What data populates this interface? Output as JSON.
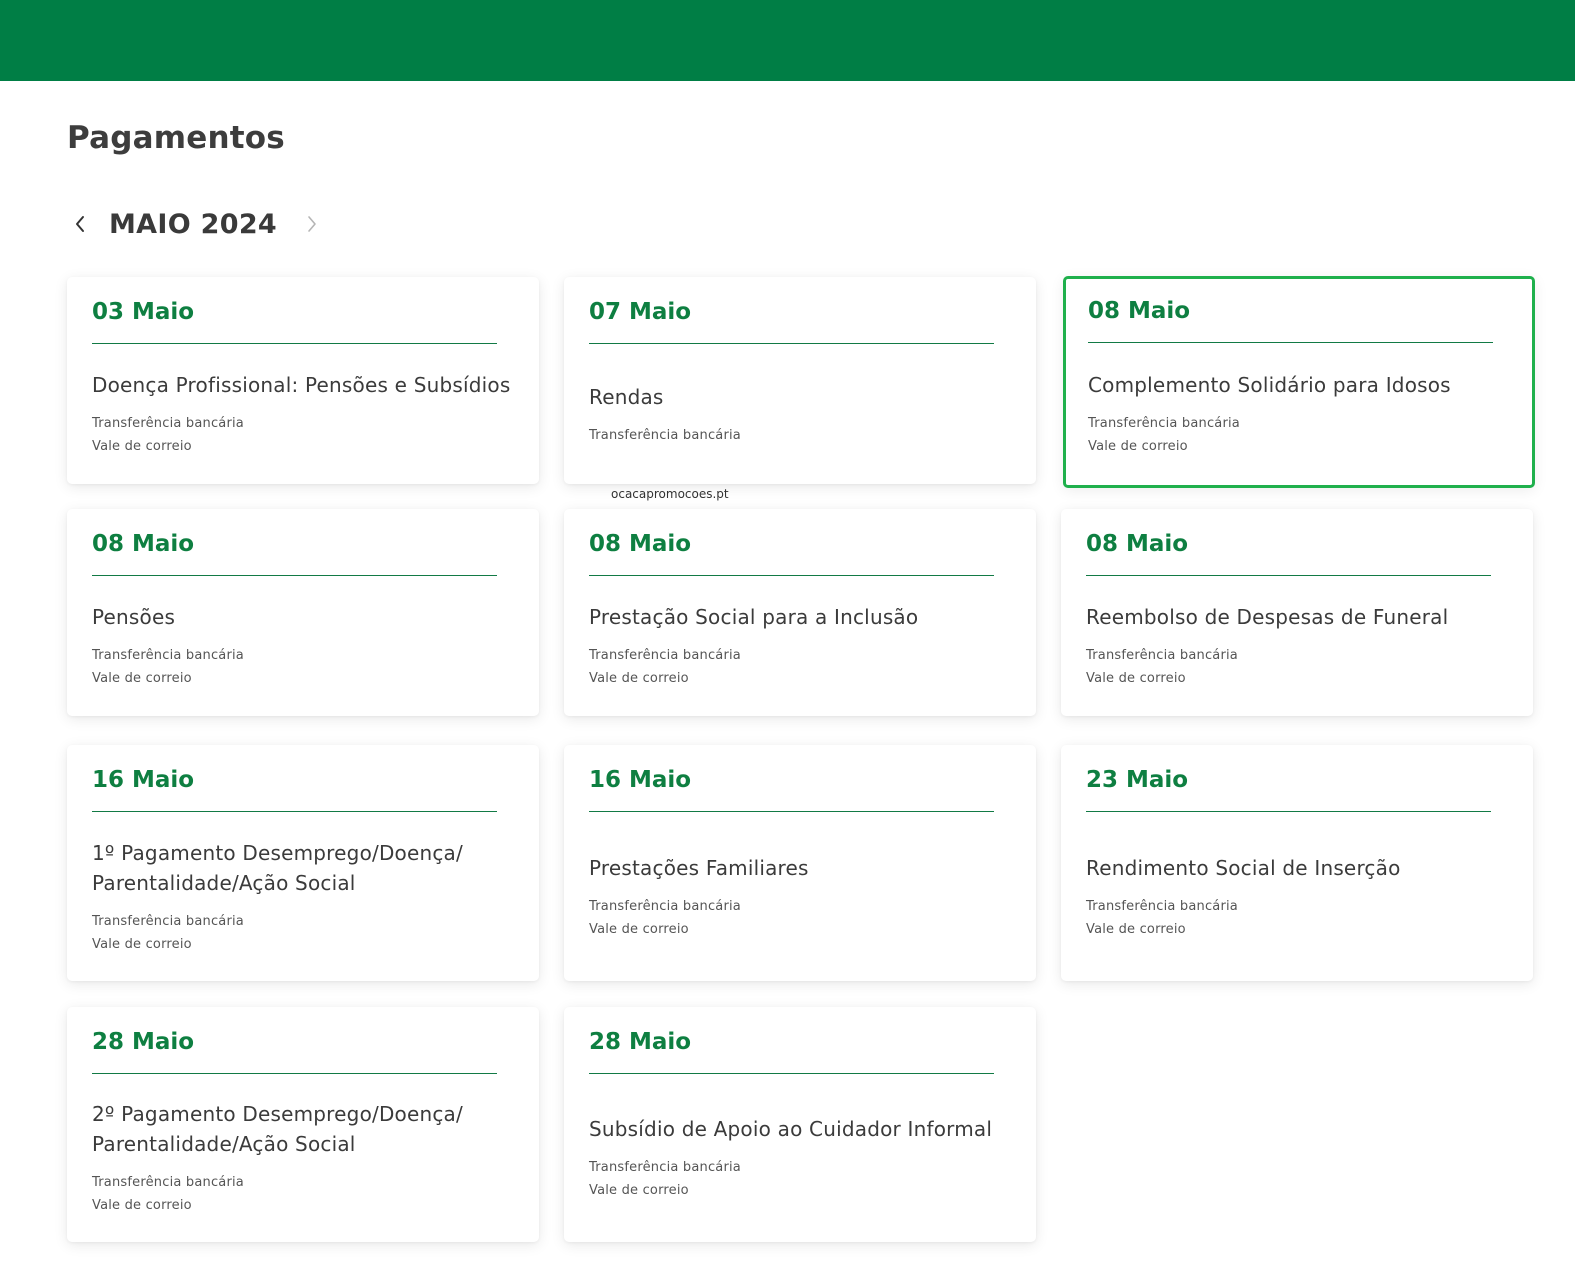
{
  "page": {
    "title": "Pagamentos",
    "month_label": "MAIO 2024",
    "prev_icon": "chevron-left-icon",
    "next_icon": "chevron-right-icon",
    "watermark": "ocacapromocoes.pt"
  },
  "colors": {
    "header_green": "#007e45",
    "date_green": "#0e7f41",
    "highlight_border": "#1fb04c"
  },
  "payments": [
    {
      "date": "03 Maio",
      "service": "Doença Profissional: Pensões e Subsídios",
      "methods": [
        "Transferência bancária",
        "Vale de correio"
      ],
      "highlighted": false
    },
    {
      "date": "07 Maio",
      "service": "Rendas",
      "methods": [
        "Transferência bancária"
      ],
      "highlighted": false
    },
    {
      "date": "08 Maio",
      "service": "Complemento Solidário para Idosos",
      "methods": [
        "Transferência bancária",
        "Vale de correio"
      ],
      "highlighted": true
    },
    {
      "date": "08 Maio",
      "service": "Pensões",
      "methods": [
        "Transferência bancária",
        "Vale de correio"
      ],
      "highlighted": false
    },
    {
      "date": "08 Maio",
      "service": "Prestação Social para a Inclusão",
      "methods": [
        "Transferência bancária",
        "Vale de correio"
      ],
      "highlighted": false
    },
    {
      "date": "08 Maio",
      "service": "Reembolso de Despesas de Funeral",
      "methods": [
        "Transferência bancária",
        "Vale de correio"
      ],
      "highlighted": false
    },
    {
      "date": "16 Maio",
      "service": "1º Pagamento Desemprego/Doença/ Parentalidade/Ação Social",
      "methods": [
        "Transferência bancária",
        "Vale de correio"
      ],
      "highlighted": false
    },
    {
      "date": "16 Maio",
      "service": "Prestações Familiares",
      "methods": [
        "Transferência bancária",
        "Vale de correio"
      ],
      "highlighted": false
    },
    {
      "date": "23 Maio",
      "service": "Rendimento Social de Inserção",
      "methods": [
        "Transferência bancária",
        "Vale de correio"
      ],
      "highlighted": false
    },
    {
      "date": "28 Maio",
      "service": "2º Pagamento Desemprego/Doença/ Parentalidade/Ação Social",
      "methods": [
        "Transferência bancária",
        "Vale de correio"
      ],
      "highlighted": false
    },
    {
      "date": "28 Maio",
      "service": "Subsídio de Apoio ao Cuidador Informal",
      "methods": [
        "Transferência bancária",
        "Vale de correio"
      ],
      "highlighted": false
    }
  ]
}
